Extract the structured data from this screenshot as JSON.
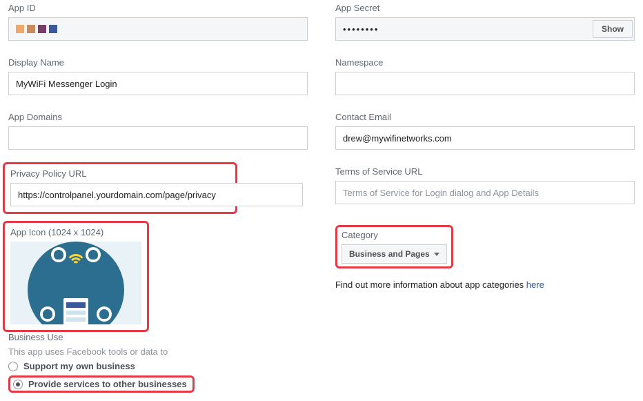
{
  "appId": {
    "label": "App ID"
  },
  "appSecret": {
    "label": "App Secret",
    "masked": "••••••••",
    "showBtn": "Show"
  },
  "displayName": {
    "label": "Display Name",
    "value": "MyWiFi Messenger Login"
  },
  "namespace": {
    "label": "Namespace",
    "value": ""
  },
  "appDomains": {
    "label": "App Domains",
    "value": ""
  },
  "contactEmail": {
    "label": "Contact Email",
    "value": "drew@mywifinetworks.com"
  },
  "privacy": {
    "label": "Privacy Policy URL",
    "value": "https://controlpanel.yourdomain.com/page/privacy"
  },
  "tos": {
    "label": "Terms of Service URL",
    "placeholder": "Terms of Service for Login dialog and App Details",
    "value": ""
  },
  "appIcon": {
    "label": "App Icon (1024 x 1024)"
  },
  "category": {
    "label": "Category",
    "selected": "Business and Pages",
    "helpPrefix": "Find out more information about app categories ",
    "helpLink": "here"
  },
  "businessUse": {
    "label": "Business Use",
    "sub": "This app uses Facebook tools or data to",
    "option1": "Support my own business",
    "option2": "Provide services to other businesses",
    "selected": "option2"
  },
  "colors": {
    "pix": [
      "#f0a868",
      "#c78b5e",
      "#7a3b69",
      "#3b5998"
    ]
  }
}
